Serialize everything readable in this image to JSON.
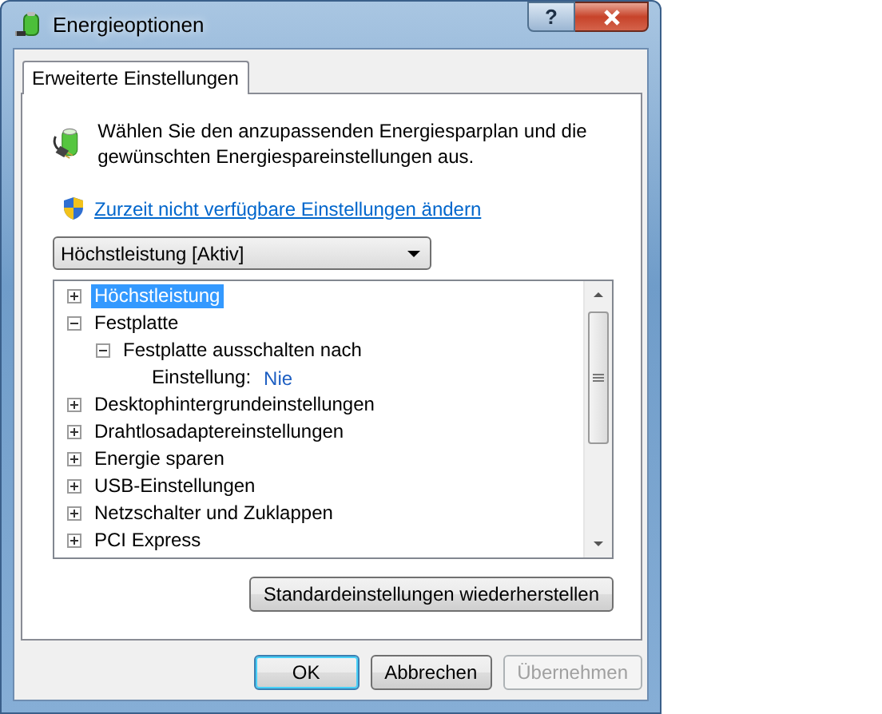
{
  "window": {
    "title": "Energieoptionen",
    "help_button": "?"
  },
  "tabs": [
    {
      "label": "Erweiterte Einstellungen",
      "selected": true
    }
  ],
  "description": "Wählen Sie den anzupassenden Energiesparplan und die gewünschten Energiespareinstellungen aus.",
  "link": "Zurzeit nicht verfügbare Einstellungen ändern",
  "plan_dropdown": {
    "value": "Höchstleistung [Aktiv]"
  },
  "tree": [
    {
      "kind": "node",
      "label": "Höchstleistung",
      "expanded": false,
      "selected": true
    },
    {
      "kind": "node",
      "label": "Festplatte",
      "expanded": true,
      "selected": false,
      "children": [
        {
          "kind": "node",
          "label": "Festplatte ausschalten nach",
          "expanded": true,
          "selected": false,
          "children": [
            {
              "kind": "setting",
              "label": "Einstellung:",
              "value": "Nie"
            }
          ]
        }
      ]
    },
    {
      "kind": "node",
      "label": "Desktophintergrundeinstellungen",
      "expanded": false,
      "selected": false
    },
    {
      "kind": "node",
      "label": "Drahtlosadaptereinstellungen",
      "expanded": false,
      "selected": false
    },
    {
      "kind": "node",
      "label": "Energie sparen",
      "expanded": false,
      "selected": false
    },
    {
      "kind": "node",
      "label": "USB-Einstellungen",
      "expanded": false,
      "selected": false
    },
    {
      "kind": "node",
      "label": "Netzschalter und Zuklappen",
      "expanded": false,
      "selected": false
    },
    {
      "kind": "node",
      "label": "PCI Express",
      "expanded": false,
      "selected": false
    }
  ],
  "restore_button": "Standardeinstellungen wiederherstellen",
  "buttons": [
    {
      "label": "OK",
      "disabled": false,
      "default": true
    },
    {
      "label": "Abbrechen",
      "disabled": false,
      "default": false
    },
    {
      "label": "Übernehmen",
      "disabled": true,
      "default": false
    }
  ]
}
